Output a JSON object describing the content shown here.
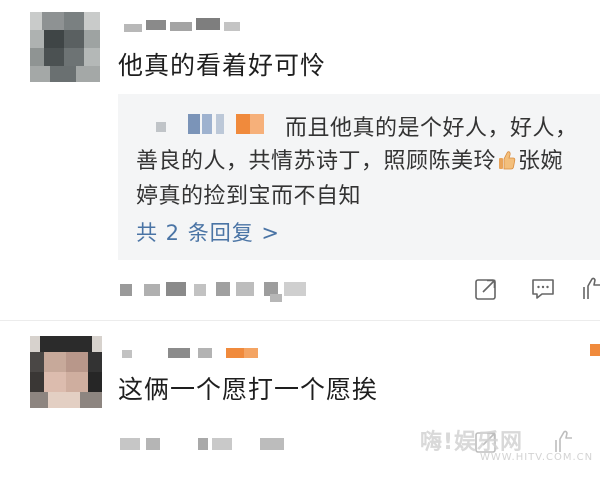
{
  "comments": [
    {
      "text": "他真的看着好可怜",
      "reply": {
        "text_line1": "而且他真的是个好人，好人，",
        "text_line2a": "善良的人，共情苏诗丁，照顾陈美玲",
        "text_line2b": "张婉",
        "text_line3": "婷真的捡到宝而不自知",
        "more_label": "共 2 条回复 >"
      }
    },
    {
      "text": "这俩一个愿打一个愿挨"
    }
  ],
  "watermark": {
    "main": "嗨!娱乐网",
    "sub": "WWW.HITV.COM.CN"
  },
  "colors": {
    "link": "#4a74a5",
    "reply_bg": "#f4f5f6",
    "accent_orange": "#f08a3c"
  },
  "icons": [
    "share-icon",
    "comment-icon",
    "like-icon"
  ]
}
